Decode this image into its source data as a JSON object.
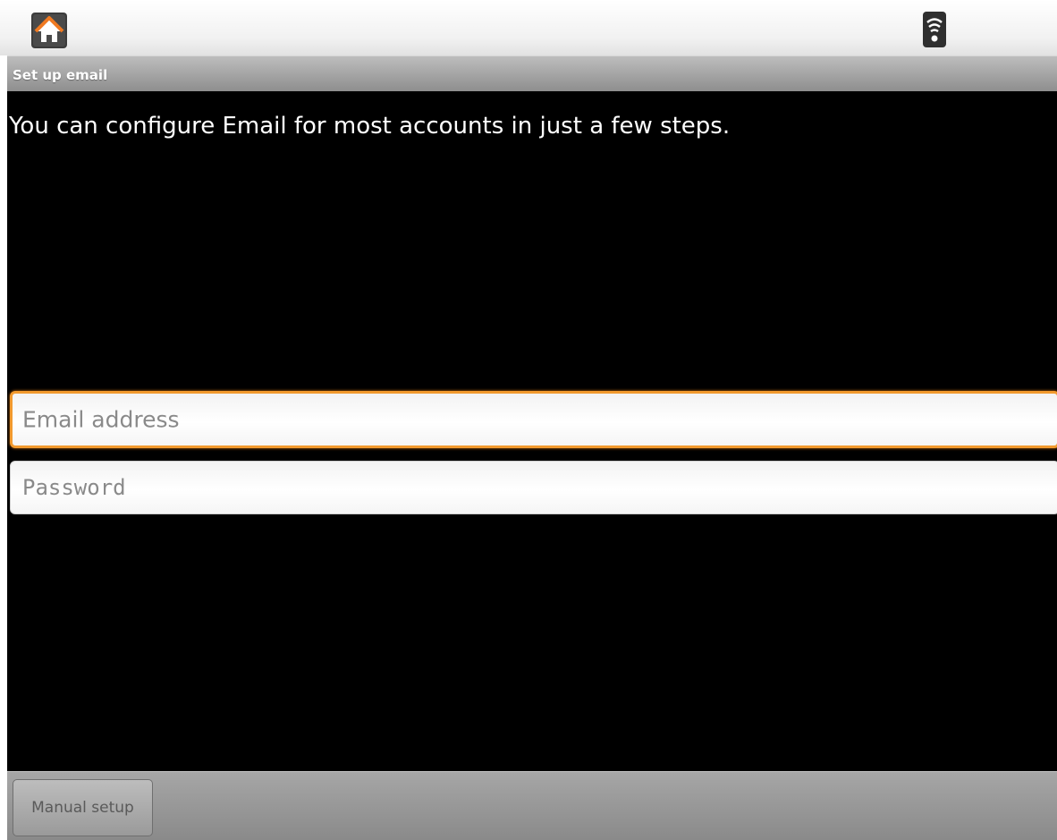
{
  "status_bar": {
    "home_icon": "home-icon",
    "signal_icon": "wifi-signal-icon"
  },
  "title_bar": {
    "title": "Set up email"
  },
  "main": {
    "intro": "You can configure Email for most accounts in just a few steps.",
    "email_field": {
      "placeholder": "Email address",
      "value": ""
    },
    "password_field": {
      "placeholder": "Password",
      "value": ""
    }
  },
  "bottom_bar": {
    "manual_setup_label": "Manual setup"
  },
  "colors": {
    "focus_accent": "#f29a2e",
    "home_icon": "#f07a22",
    "background": "#000000"
  }
}
